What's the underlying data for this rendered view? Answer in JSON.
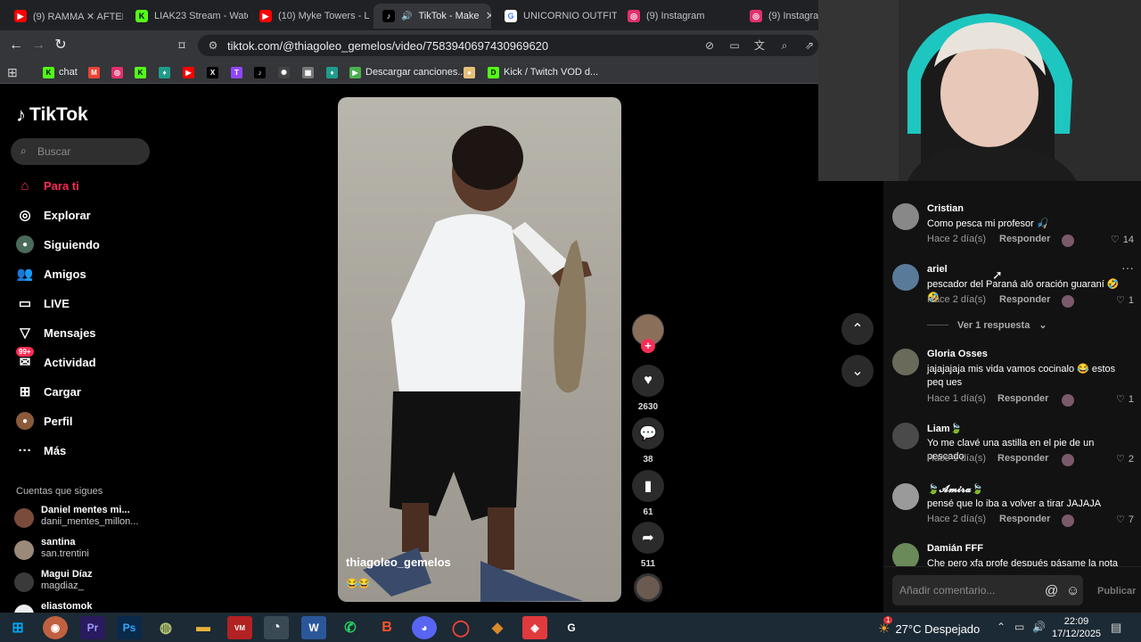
{
  "browser": {
    "tabs": [
      {
        "label": "(9) RAMMA ✕ AFTER",
        "color": "#ff0000",
        "glyph": "▶"
      },
      {
        "label": "LIAK23 Stream - Watc",
        "color": "#53fc18",
        "glyph": "K"
      },
      {
        "label": "(10) Myke Towers - Li",
        "color": "#ff0000",
        "glyph": "▶"
      },
      {
        "label": "TikTok - Make",
        "color": "#000000",
        "glyph": "♪"
      },
      {
        "label": "UNICORNIO OUTFIT",
        "color": "#4285f4",
        "glyph": "G"
      },
      {
        "label": "(9) Instagram",
        "color": "#e1306c",
        "glyph": "◎"
      },
      {
        "label": "(9) Instagram",
        "color": "#e1306c",
        "glyph": "◎"
      }
    ],
    "url": "tiktok.com/@thiagoleo_gemelos/video/7583940697430969620",
    "bookmarks": [
      {
        "label": "chat",
        "color": "#53fc18",
        "glyph": "K"
      },
      {
        "label": "",
        "color": "#ea4335",
        "glyph": "M"
      },
      {
        "label": "",
        "color": "#e1306c",
        "glyph": "◎"
      },
      {
        "label": "",
        "color": "#53fc18",
        "glyph": "K"
      },
      {
        "label": "",
        "color": "#1f9c8c",
        "glyph": "♦"
      },
      {
        "label": "",
        "color": "#ff0000",
        "glyph": "▶"
      },
      {
        "label": "",
        "color": "#000000",
        "glyph": "X"
      },
      {
        "label": "",
        "color": "#9146ff",
        "glyph": "T"
      },
      {
        "label": "",
        "color": "#000000",
        "glyph": "♪"
      },
      {
        "label": "",
        "color": "#444444",
        "glyph": "✺"
      },
      {
        "label": "",
        "color": "#777777",
        "glyph": "▦"
      },
      {
        "label": "",
        "color": "#1f9c8c",
        "glyph": "♦"
      },
      {
        "label": "Descargar canciones...",
        "color": "#4caf50",
        "glyph": "▶"
      },
      {
        "label": "",
        "color": "#e6c07b",
        "glyph": "●"
      },
      {
        "label": "Kick / Twitch VOD d...",
        "color": "#53fc18",
        "glyph": "D"
      }
    ]
  },
  "tiktok": {
    "logo": "TikTok",
    "search_placeholder": "Buscar",
    "nav": [
      {
        "label": "Para ti",
        "icon": "home-icon",
        "glyph": "⌂"
      },
      {
        "label": "Explorar",
        "icon": "compass-icon",
        "glyph": "◎"
      },
      {
        "label": "Siguiendo",
        "icon": "following-icon",
        "glyph": "●"
      },
      {
        "label": "Amigos",
        "icon": "friends-icon",
        "glyph": "👥"
      },
      {
        "label": "LIVE",
        "icon": "live-icon",
        "glyph": "▭"
      },
      {
        "label": "Mensajes",
        "icon": "messages-icon",
        "glyph": "▽"
      },
      {
        "label": "Actividad",
        "icon": "activity-icon",
        "glyph": "✉",
        "badge": "99+"
      },
      {
        "label": "Cargar",
        "icon": "upload-icon",
        "glyph": "⊞"
      },
      {
        "label": "Perfil",
        "icon": "profile-icon",
        "glyph": "●"
      },
      {
        "label": "Más",
        "icon": "more-icon",
        "glyph": "···"
      }
    ],
    "following_title": "Cuentas que sigues",
    "following": [
      {
        "name": "Daniel mentes mi...",
        "user": "danii_mentes_millon..."
      },
      {
        "name": "santina",
        "user": "san.trentini"
      },
      {
        "name": "Magui Díaz",
        "user": "magdiaz_"
      },
      {
        "name": "eliastomok",
        "user": ""
      }
    ],
    "video": {
      "author": "thiagoleo_gemelos",
      "caption": "😂😂",
      "likes": "2630",
      "comments": "38",
      "saves": "61",
      "shares": "511"
    },
    "comments": [
      {
        "name": "Cristian",
        "text": "Como pesca mi profesor 🎣",
        "time": "Hace 2 día(s)",
        "reply": "Responder",
        "likes": "14"
      },
      {
        "name": "ariel",
        "text": "pescador del Paraná aló oración guaraní 🤣🤣",
        "time": "Hace 2 día(s)",
        "reply": "Responder",
        "likes": "1"
      },
      {
        "name": "Gloria Osses",
        "text": "jajajajaja mis vida vamos cocinalo 😂 estos peq ues",
        "time": "Hace 1 día(s)",
        "reply": "Responder",
        "likes": "1"
      },
      {
        "name": "Liam🍃",
        "text": "Yo me clavé una astilla en el pie de un pescado",
        "time": "Hace 1 día(s)",
        "reply": "Responder",
        "likes": "2"
      },
      {
        "name": "🍃𝓐𝓶𝓲𝓻𝓪🍃",
        "text": "pensé que lo iba a volver a tirar JAJAJA",
        "time": "Hace 2 día(s)",
        "reply": "Responder",
        "likes": "7"
      },
      {
        "name": "Damián FFF",
        "text": "Che pero xfa profe después pásame la nota 😂",
        "time": "",
        "reply": "",
        "likes": ""
      }
    ],
    "view_replies": "Ver 1 respuesta",
    "comment_placeholder": "Añadir comentario...",
    "publish": "Publicar"
  },
  "taskbar": {
    "weather": "27°C  Despejado",
    "time": "22:09",
    "date": "17/12/2025",
    "notif_badge": "1",
    "apps": [
      {
        "name": "windows-start",
        "glyph": "⊞",
        "color": "#00a4ef"
      },
      {
        "name": "app-2",
        "glyph": "◉",
        "color": "#c06040"
      },
      {
        "name": "premiere",
        "glyph": "Pr",
        "color": "#2a1a5e"
      },
      {
        "name": "photoshop",
        "glyph": "Ps",
        "color": "#0a2a4a"
      },
      {
        "name": "app-5",
        "glyph": "◍",
        "color": "#556b2f"
      },
      {
        "name": "explorer",
        "glyph": "▬",
        "color": "#e8b339"
      },
      {
        "name": "voicemeeter",
        "glyph": "VM",
        "color": "#b22222"
      },
      {
        "name": "obs",
        "glyph": "◔",
        "color": "#303030"
      },
      {
        "name": "word",
        "glyph": "W",
        "color": "#2b579a"
      },
      {
        "name": "whatsapp",
        "glyph": "✆",
        "color": "#25d366"
      },
      {
        "name": "brave",
        "glyph": "B",
        "color": "#fb542b"
      },
      {
        "name": "discord",
        "glyph": "◕",
        "color": "#5865f2"
      },
      {
        "name": "chrome",
        "glyph": "◯",
        "color": "#ea4335"
      },
      {
        "name": "app-14",
        "glyph": "◆",
        "color": "#d88a2a"
      },
      {
        "name": "app-15",
        "glyph": "◈",
        "color": "#e03a3e"
      },
      {
        "name": "app-16",
        "glyph": "G",
        "color": "#303030"
      }
    ]
  }
}
